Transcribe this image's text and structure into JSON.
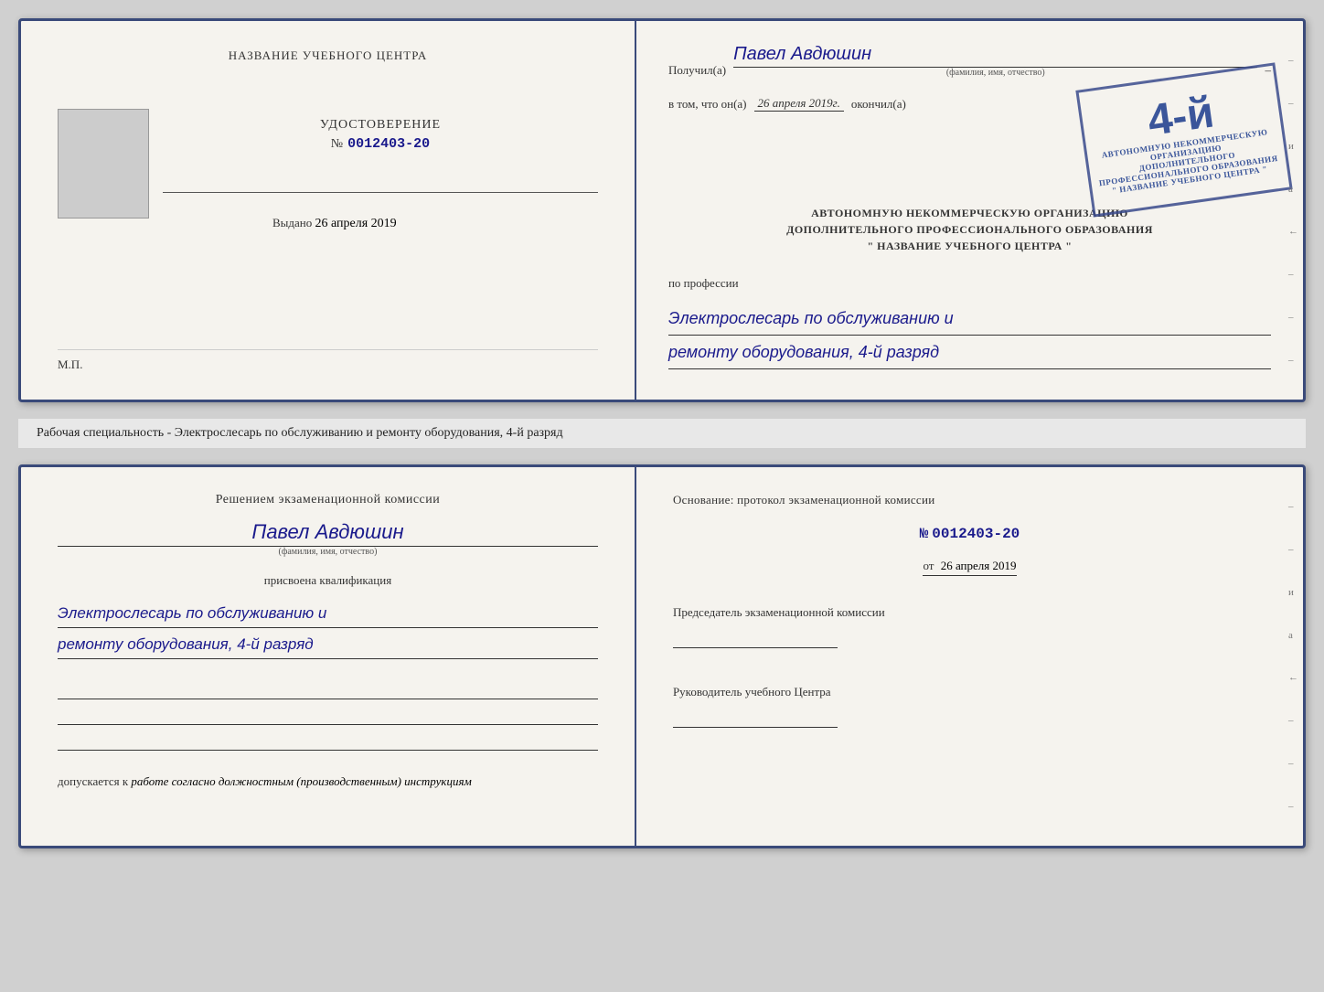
{
  "top_doc": {
    "left": {
      "title": "НАЗВАНИЕ УЧЕБНОГО ЦЕНТРА",
      "udostoverenie_label": "УДОСТОВЕРЕНИЕ",
      "number_prefix": "№",
      "number": "0012403-20",
      "vydano_label": "Выдано",
      "vydano_date": "26 апреля 2019",
      "mp_label": "М.П."
    },
    "right": {
      "poluchil_prefix": "Получил(а)",
      "person_name": "Павел Авдюшин",
      "fio_hint": "(фамилия, имя, отчество)",
      "vtom_prefix": "в том, что он(а)",
      "vtom_date": "26 апреля 2019г.",
      "okончил_label": "окончил(а)",
      "stamp_number": "4-й",
      "stamp_line1": "АВТОНОМНУЮ НЕКОММЕРЧЕСКУЮ ОРГАНИЗАЦИЮ",
      "stamp_line2": "ДОПОЛНИТЕЛЬНОГО ПРОФЕССИОНАЛЬНОГО ОБРАЗОВАНИЯ",
      "stamp_line3": "\" НАЗВАНИЕ УЧЕБНОГО ЦЕНТРА \"",
      "po_professii_label": "по профессии",
      "profession_line1": "Электрослесарь по обслуживанию и",
      "profession_line2": "ремонту оборудования, 4-й разряд"
    }
  },
  "middle": {
    "text": "Рабочая специальность - Электрослесарь по обслуживанию и ремонту оборудования, 4-й разряд"
  },
  "bottom_doc": {
    "left": {
      "decision_title": "Решением экзаменационной комиссии",
      "person_name": "Павел Авдюшин",
      "fio_hint": "(фамилия, имя, отчество)",
      "prisvoena_label": "присвоена квалификация",
      "qualification_line1": "Электрослесарь по обслуживанию и",
      "qualification_line2": "ремонту оборудования, 4-й разряд",
      "допускается_label": "допускается к",
      "dopusk_text": "работе согласно должностным (производственным) инструкциям"
    },
    "right": {
      "osnovaniye_label": "Основание: протокол экзаменационной комиссии",
      "number_prefix": "№",
      "protocol_number": "0012403-20",
      "ot_label": "от",
      "ot_date": "26 апреля 2019",
      "chairman_label": "Председатель экзаменационной комиссии",
      "rukovoditel_label": "Руководитель учебного Центра"
    }
  },
  "edge_marks": {
    "top_right": [
      "и",
      "а",
      "←",
      "–",
      "–",
      "–"
    ],
    "bottom_right": [
      "и",
      "а",
      "←",
      "–",
      "–",
      "–"
    ]
  }
}
